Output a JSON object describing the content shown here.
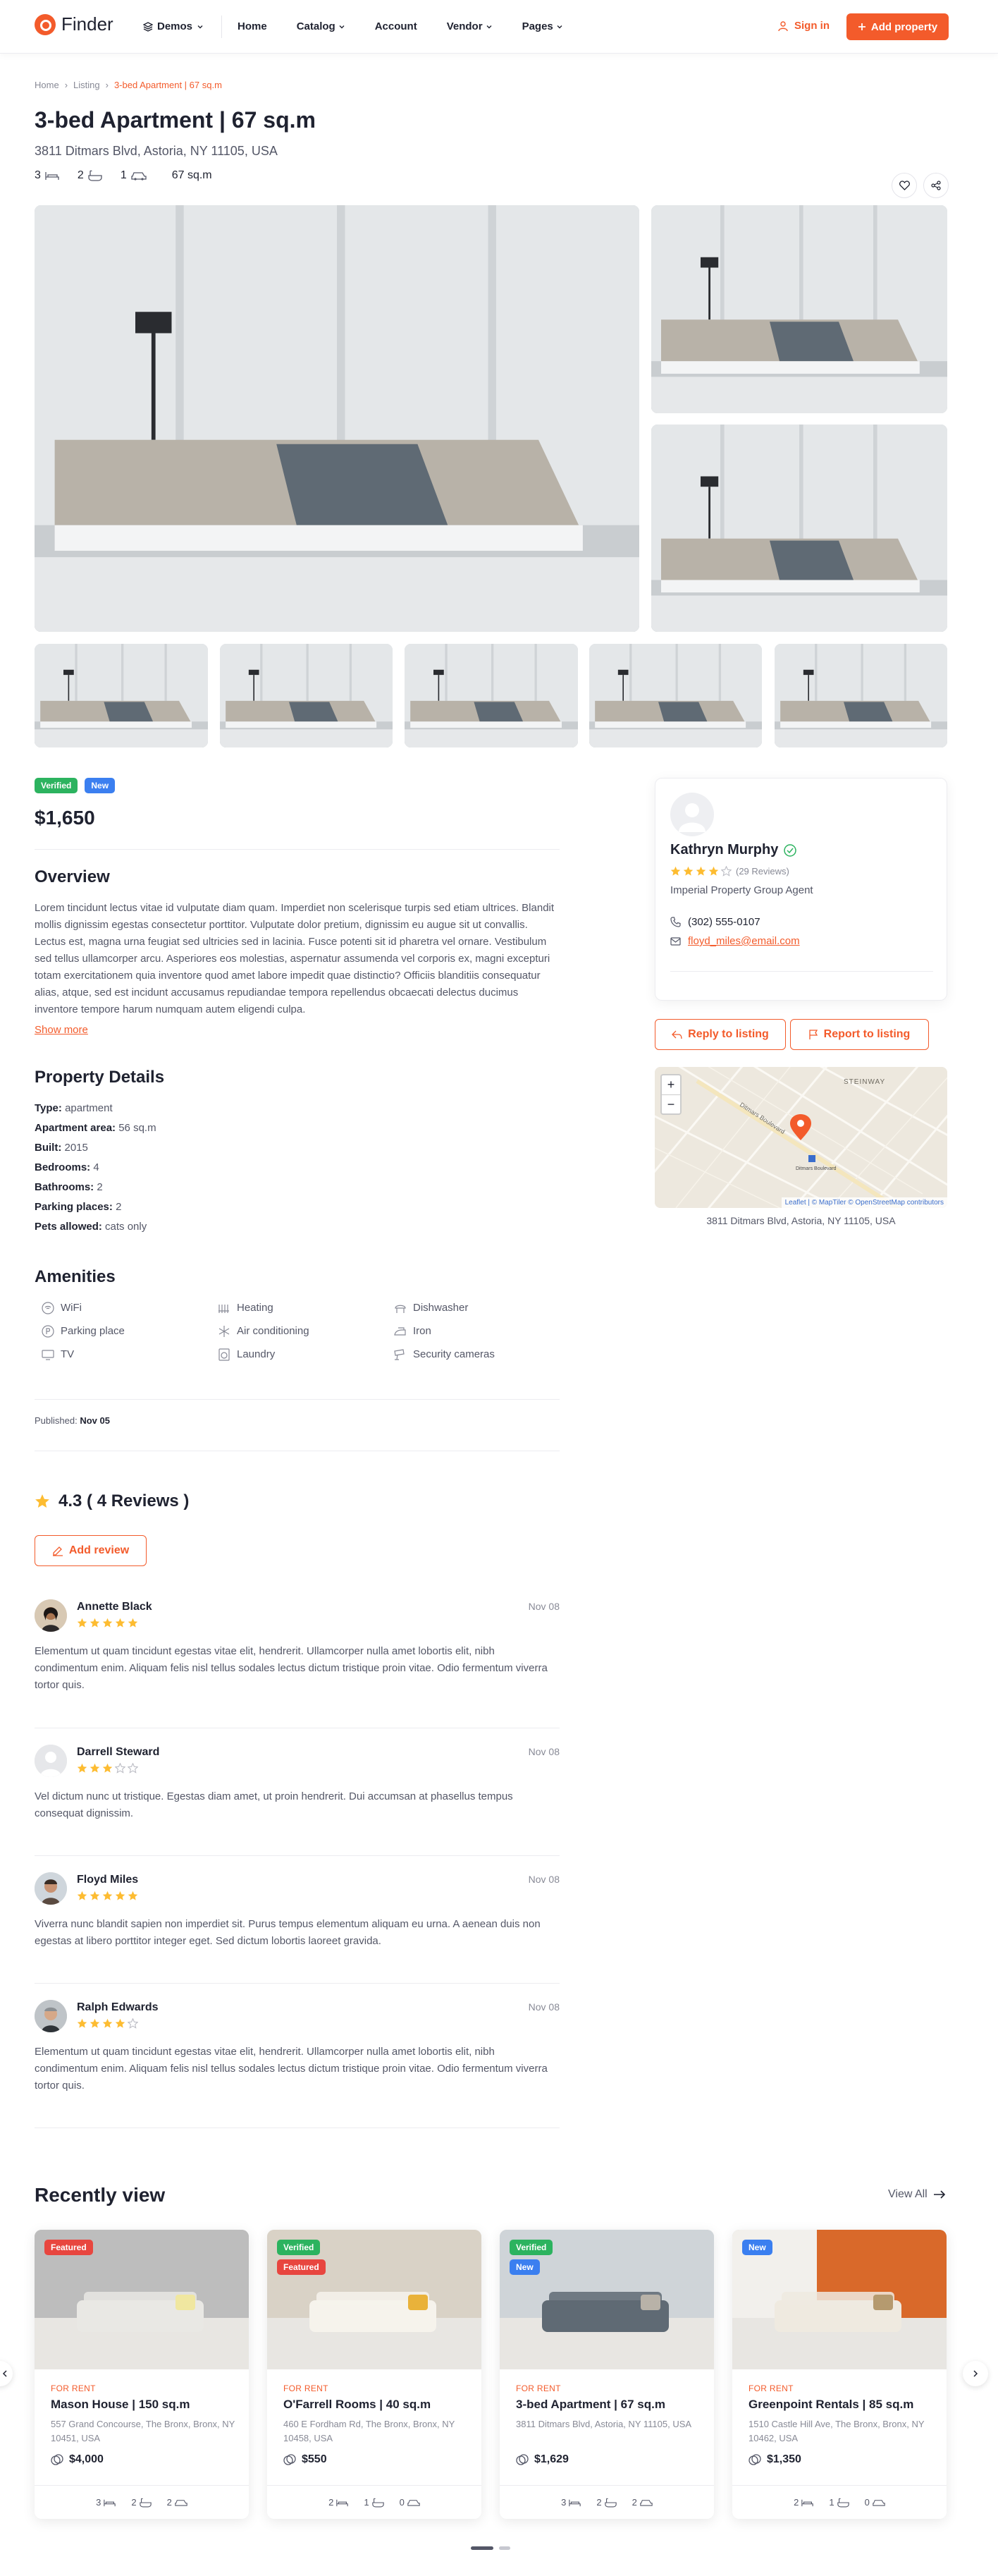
{
  "header": {
    "logo": "Finder",
    "demos": "Demos",
    "nav": [
      "Home",
      "Catalog",
      "Account",
      "Vendor",
      "Pages"
    ],
    "sign_in": "Sign in",
    "add_property": "Add property"
  },
  "breadcrumb": [
    "Home",
    "Listing",
    "3-bed Apartment | 67 sq.m"
  ],
  "listing": {
    "title": "3-bed Apartment | 67 sq.m",
    "address": "3811 Ditmars Blvd, Astoria, NY 11105, USA",
    "beds": "3",
    "baths": "2",
    "parking": "1",
    "area": "67 sq.m",
    "badges": [
      "Verified",
      "New"
    ],
    "price": "$1,650"
  },
  "overview": {
    "heading": "Overview",
    "text": "Lorem tincidunt lectus vitae id vulputate diam quam. Imperdiet non scelerisque turpis sed etiam ultrices. Blandit mollis dignissim egestas consectetur porttitor. Vulputate dolor pretium, dignissim eu augue sit ut convallis. Lectus est, magna urna feugiat sed ultricies sed in lacinia. Fusce potenti sit id pharetra vel ornare. Vestibulum sed tellus ullamcorper arcu. Asperiores eos molestias, aspernatur assumenda vel corporis ex, magni excepturi totam exercitationem quia inventore quod amet labore impedit quae distinctio? Officiis blanditiis consequatur alias, atque, sed est incidunt accusamus repudiandae tempora repellendus obcaecati delectus ducimus inventore tempore harum numquam autem eligendi culpa.",
    "show_more": "Show more"
  },
  "details": {
    "heading": "Property Details",
    "rows": [
      {
        "label": "Type:",
        "value": "apartment"
      },
      {
        "label": "Apartment area:",
        "value": "56 sq.m"
      },
      {
        "label": "Built:",
        "value": "2015"
      },
      {
        "label": "Bedrooms:",
        "value": "4"
      },
      {
        "label": "Bathrooms:",
        "value": "2"
      },
      {
        "label": "Parking places:",
        "value": "2"
      },
      {
        "label": "Pets allowed:",
        "value": "cats only"
      }
    ]
  },
  "amenities": {
    "heading": "Amenities",
    "col1": [
      {
        "label": "WiFi",
        "icon": "wifi-icon"
      },
      {
        "label": "Parking place",
        "icon": "parking-icon"
      },
      {
        "label": "TV",
        "icon": "tv-icon"
      }
    ],
    "col2": [
      {
        "label": "Heating",
        "icon": "heating-icon"
      },
      {
        "label": "Air conditioning",
        "icon": "snowflake-icon"
      },
      {
        "label": "Laundry",
        "icon": "laundry-icon"
      }
    ],
    "col3": [
      {
        "label": "Dishwasher",
        "icon": "dishwasher-icon"
      },
      {
        "label": "Iron",
        "icon": "iron-icon"
      },
      {
        "label": "Security cameras",
        "icon": "camera-icon"
      }
    ]
  },
  "published": {
    "label": "Published:",
    "date": "Nov 05"
  },
  "reviews": {
    "summary": "4.3 ( 4 Reviews )",
    "add_review": "Add review",
    "items": [
      {
        "name": "Annette Black",
        "date": "Nov 08",
        "rating": 5,
        "text": "Elementum ut quam tincidunt egestas vitae elit, hendrerit. Ullamcorper nulla amet lobortis elit, nibh condimentum enim. Aliquam felis nisl tellus sodales lectus dictum tristique proin vitae. Odio fermentum viverra tortor quis."
      },
      {
        "name": "Darrell Steward",
        "date": "Nov 08",
        "rating": 3,
        "text": "Vel dictum nunc ut tristique. Egestas diam amet, ut proin hendrerit. Dui accumsan at phasellus tempus consequat dignissim."
      },
      {
        "name": "Floyd Miles",
        "date": "Nov 08",
        "rating": 5,
        "text": "Viverra nunc blandit sapien non imperdiet sit. Purus tempus elementum aliquam eu urna. A aenean duis non egestas at libero porttitor integer eget. Sed dictum lobortis laoreet gravida."
      },
      {
        "name": "Ralph Edwards",
        "date": "Nov 08",
        "rating": 4,
        "text": "Elementum ut quam tincidunt egestas vitae elit, hendrerit. Ullamcorper nulla amet lobortis elit, nibh condimentum enim. Aliquam felis nisl tellus sodales lectus dictum tristique proin vitae. Odio fermentum viverra tortor quis."
      }
    ]
  },
  "agent": {
    "name": "Kathryn Murphy",
    "reviews": "(29 Reviews)",
    "rating": 4,
    "company": "Imperial Property Group Agent",
    "phone": "(302) 555-0107",
    "email": "floyd_miles@email.com",
    "reply": "Reply to listing",
    "report": "Report to listing"
  },
  "map": {
    "caption": "3811 Ditmars Blvd, Astoria, NY 11105, USA",
    "attribution": "Leaflet | © MapTiler © OpenStreetMap contributors",
    "label_area": "STEINWAY",
    "label_street": "Ditmars Boulevard",
    "label_station": "Ditmars Boulevard"
  },
  "recently": {
    "heading": "Recently view",
    "view_all": "View All",
    "cards": [
      {
        "badges": [
          {
            "t": "Featured",
            "c": "red"
          }
        ],
        "type": "FOR RENT",
        "title": "Mason House | 150 sq.m",
        "address": "557 Grand Concourse, The Bronx, Bronx, NY 10451, USA",
        "price": "$4,000",
        "beds": "3",
        "baths": "2",
        "cars": "2"
      },
      {
        "badges": [
          {
            "t": "Verified",
            "c": "green"
          },
          {
            "t": "Featured",
            "c": "red"
          }
        ],
        "type": "FOR RENT",
        "title": "O'Farrell Rooms | 40 sq.m",
        "address": "460 E Fordham Rd, The Bronx, Bronx, NY 10458, USA",
        "price": "$550",
        "beds": "2",
        "baths": "1",
        "cars": "0"
      },
      {
        "badges": [
          {
            "t": "Verified",
            "c": "green"
          },
          {
            "t": "New",
            "c": "blue"
          }
        ],
        "type": "FOR RENT",
        "title": "3-bed Apartment | 67 sq.m",
        "address": "3811 Ditmars Blvd, Astoria, NY 11105, USA",
        "price": "$1,629",
        "beds": "3",
        "baths": "2",
        "cars": "2"
      },
      {
        "badges": [
          {
            "t": "New",
            "c": "blue"
          }
        ],
        "type": "FOR RENT",
        "title": "Greenpoint Rentals | 85 sq.m",
        "address": "1510 Castle Hill Ave, The Bronx, Bronx, NY 10462, USA",
        "price": "$1,350",
        "beds": "2",
        "baths": "1",
        "cars": "0"
      }
    ]
  },
  "colors": {
    "accent": "#f35b2b",
    "star": "#fdbc31",
    "verified": "#2cb35f",
    "new": "#3b7ff0"
  }
}
